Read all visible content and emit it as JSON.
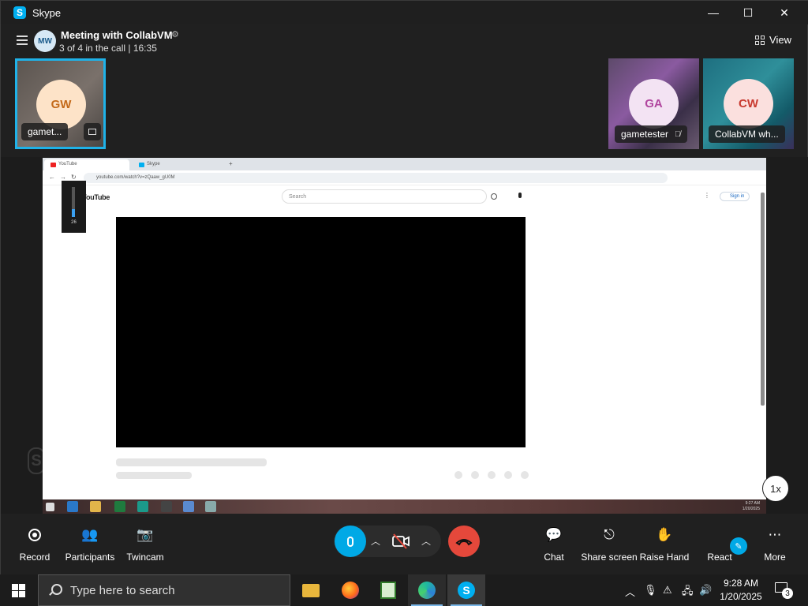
{
  "window": {
    "title": "Skype",
    "controls": {
      "minimize": "—",
      "maximize": "☐",
      "close": "✕"
    }
  },
  "header": {
    "avatar_initials": "MW",
    "meeting_title": "Meeting with CollabVM",
    "call_status": "3 of 4 in the call | 16:35",
    "view_label": "View"
  },
  "participants": [
    {
      "initials": "GW",
      "name": "gamet...",
      "avatar_bg": "#fde3c8",
      "avatar_color": "#c46a1a",
      "highlighted": true
    },
    {
      "initials": "GA",
      "name": "gametester",
      "avatar_bg": "#f3e3f3",
      "avatar_color": "#b0459e",
      "muted": true
    },
    {
      "initials": "CW",
      "name": "CollabVM wh...",
      "avatar_bg": "#fbe0de",
      "avatar_color": "#c8392e"
    }
  ],
  "shared_screen": {
    "browser_tabs": [
      {
        "label": "YouTube",
        "color": "#e22"
      },
      {
        "label": "Skype",
        "color": "#00aff0"
      }
    ],
    "url": "youtube.com/watch?v=zQaaw_gU0M",
    "site_logo": "YouTube",
    "search_placeholder": "Search",
    "sign_in_label": "Sign in",
    "volume_value": "26",
    "volume_level": 0.26,
    "vm_clock_time": "9:27 AM",
    "vm_clock_date": "1/20/2025"
  },
  "playback_speed": "1x",
  "controls": {
    "record": "Record",
    "participants": "Participants",
    "twincam": "Twincam",
    "chat": "Chat",
    "share_screen": "Share screen",
    "raise_hand": "Raise Hand",
    "react": "React",
    "more": "More"
  },
  "taskbar": {
    "search_placeholder": "Type here to search",
    "time": "9:28 AM",
    "date": "1/20/2025",
    "notification_count": "3"
  },
  "colors": {
    "accent": "#00a9e6",
    "hangup": "#e5483b",
    "background": "#202020"
  }
}
